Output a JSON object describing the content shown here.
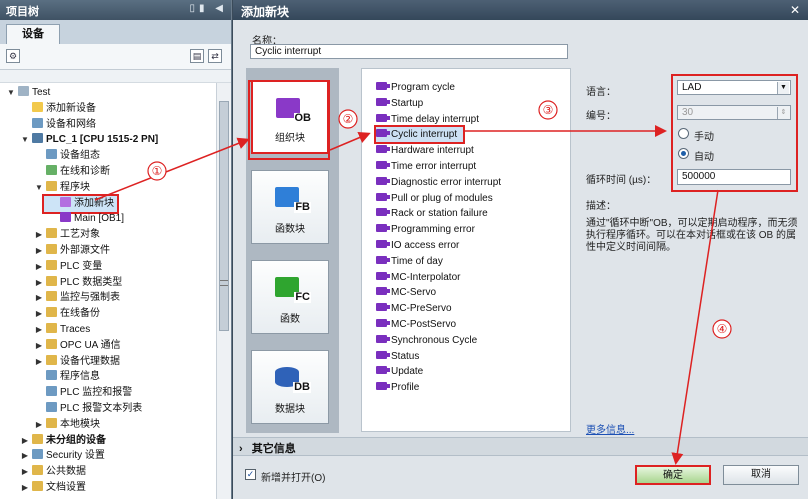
{
  "project_panel": {
    "title": "项目树",
    "tab": "设备",
    "tree": [
      {
        "label": "Test",
        "level": 0,
        "expand": "▼",
        "icon": "project-icon",
        "color": "#9fb3c5"
      },
      {
        "label": "添加新设备",
        "level": 1,
        "expand": "",
        "icon": "add-device-icon",
        "color": "#f2c94c"
      },
      {
        "label": "设备和网络",
        "level": 1,
        "expand": "",
        "icon": "network-icon",
        "color": "#6d9ac2"
      },
      {
        "label": "PLC_1 [CPU 1515-2 PN]",
        "level": 1,
        "expand": "▼",
        "icon": "plc-icon",
        "color": "#4f7aa3",
        "bold": true
      },
      {
        "label": "设备组态",
        "level": 2,
        "expand": "",
        "icon": "config-icon",
        "color": "#6d9ac2"
      },
      {
        "label": "在线和诊断",
        "level": 2,
        "expand": "",
        "icon": "diagnostics-icon",
        "color": "#66b066"
      },
      {
        "label": "程序块",
        "level": 2,
        "expand": "▼",
        "icon": "folder-icon",
        "color": "#e0b64a"
      },
      {
        "label": "添加新块",
        "level": 3,
        "expand": "",
        "icon": "add-block-icon",
        "color": "#b36fe0",
        "selected": true
      },
      {
        "label": "Main [OB1]",
        "level": 3,
        "expand": "",
        "icon": "ob-icon",
        "color": "#8a39c8"
      },
      {
        "label": "工艺对象",
        "level": 2,
        "expand": "▶",
        "icon": "folder-icon",
        "color": "#e0b64a"
      },
      {
        "label": "外部源文件",
        "level": 2,
        "expand": "▶",
        "icon": "folder-icon",
        "color": "#e0b64a"
      },
      {
        "label": "PLC 变量",
        "level": 2,
        "expand": "▶",
        "icon": "folder-icon",
        "color": "#e0b64a"
      },
      {
        "label": "PLC 数据类型",
        "level": 2,
        "expand": "▶",
        "icon": "folder-icon",
        "color": "#e0b64a"
      },
      {
        "label": "监控与强制表",
        "level": 2,
        "expand": "▶",
        "icon": "folder-icon",
        "color": "#e0b64a"
      },
      {
        "label": "在线备份",
        "level": 2,
        "expand": "▶",
        "icon": "folder-icon",
        "color": "#e0b64a"
      },
      {
        "label": "Traces",
        "level": 2,
        "expand": "▶",
        "icon": "folder-icon",
        "color": "#e0b64a"
      },
      {
        "label": "OPC UA 通信",
        "level": 2,
        "expand": "▶",
        "icon": "folder-icon",
        "color": "#e0b64a"
      },
      {
        "label": "设备代理数据",
        "level": 2,
        "expand": "▶",
        "icon": "folder-icon",
        "color": "#e0b64a"
      },
      {
        "label": "程序信息",
        "level": 2,
        "expand": "",
        "icon": "info-icon",
        "color": "#6d9ac2"
      },
      {
        "label": "PLC 监控和报警",
        "level": 2,
        "expand": "",
        "icon": "alarm-icon",
        "color": "#6d9ac2"
      },
      {
        "label": "PLC 报警文本列表",
        "level": 2,
        "expand": "",
        "icon": "textlist-icon",
        "color": "#6d9ac2"
      },
      {
        "label": "本地模块",
        "level": 2,
        "expand": "▶",
        "icon": "folder-icon",
        "color": "#e0b64a"
      },
      {
        "label": "未分组的设备",
        "level": 1,
        "expand": "▶",
        "icon": "folder-icon",
        "color": "#e0b64a",
        "bold": true
      },
      {
        "label": "Security 设置",
        "level": 1,
        "expand": "▶",
        "icon": "security-icon",
        "color": "#6d9ac2"
      },
      {
        "label": "公共数据",
        "level": 1,
        "expand": "▶",
        "icon": "folder-icon",
        "color": "#e0b64a"
      },
      {
        "label": "文档设置",
        "level": 1,
        "expand": "▶",
        "icon": "folder-icon",
        "color": "#e0b64a"
      }
    ]
  },
  "dialog": {
    "title": "添加新块",
    "close_glyph": "✕",
    "name_label": "名称：",
    "name_value": "Cyclic interrupt",
    "block_types": [
      {
        "tag": "OB",
        "label": "组织块",
        "color": "#8a39c8",
        "active": true
      },
      {
        "tag": "FB",
        "label": "函数块",
        "color": "#2f7fd8",
        "active": false
      },
      {
        "tag": "FC",
        "label": "函数",
        "color": "#2fa52f",
        "active": false
      },
      {
        "tag": "DB",
        "label": "数据块",
        "color": "#2f62b8",
        "active": false
      }
    ],
    "ob_list": [
      "Program cycle",
      "Startup",
      "Time delay interrupt",
      "Cyclic interrupt",
      "Hardware interrupt",
      "Time error interrupt",
      "Diagnostic error interrupt",
      "Pull or plug of modules",
      "Rack or station failure",
      "Programming error",
      "IO access error",
      "Time of day",
      "MC-Interpolator",
      "MC-Servo",
      "MC-PreServo",
      "MC-PostServo",
      "Synchronous Cycle",
      "Status",
      "Update",
      "Profile"
    ],
    "ob_selected": "Cyclic interrupt",
    "language_label": "语言：",
    "language_value": "LAD",
    "number_label": "编号：",
    "number_value": "30",
    "radio_manual": "手动",
    "radio_auto": "自动",
    "cycle_label": "循环时间 (µs)：",
    "cycle_value": "500000",
    "desc_label": "描述：",
    "desc_text": "通过\"循环中断\"OB，可以定期启动程序，而无须执行程序循环。可以在本对话框或在该 OB 的属性中定义时间间隔。",
    "more_info": "更多信息...",
    "other_info": "其它信息",
    "add_open_label": "新增并打开(O)",
    "ok": "确定",
    "cancel": "取消"
  },
  "annotations": {
    "step1": "①",
    "step2": "②",
    "step3": "③",
    "step4": "④",
    "color": "#dd2222"
  }
}
